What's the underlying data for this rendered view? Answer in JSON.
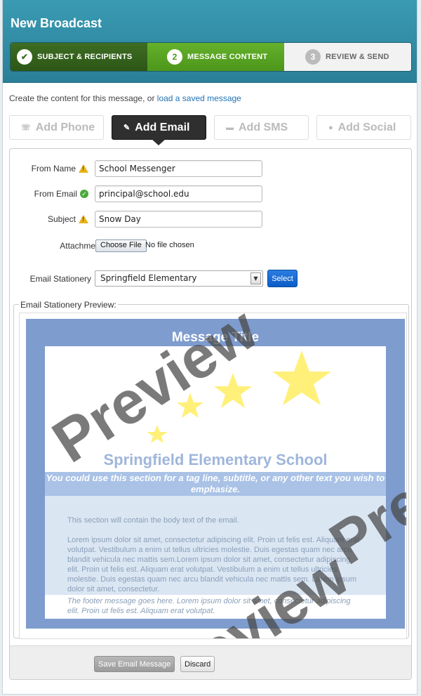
{
  "header": {
    "title": "New Broadcast"
  },
  "steps": [
    {
      "number": "✔",
      "label": "SUBJECT & RECIPIENTS",
      "state": "done"
    },
    {
      "number": "2",
      "label": "MESSAGE CONTENT",
      "state": "active"
    },
    {
      "number": "3",
      "label": "REVIEW & SEND",
      "state": "todo"
    }
  ],
  "intro": {
    "text": "Create the content for this message, or ",
    "link": "load a saved message"
  },
  "tabs": [
    {
      "label": "Add Phone",
      "icon": "phone-icon"
    },
    {
      "label": "Add Email",
      "icon": "pencil-icon"
    },
    {
      "label": "Add SMS",
      "icon": "chat-icon"
    },
    {
      "label": "Add Social",
      "icon": "user-icon"
    }
  ],
  "form": {
    "from_name": {
      "label": "From Name",
      "value": "School Messenger",
      "status": "warning"
    },
    "from_email": {
      "label": "From Email",
      "value": "principal@school.edu",
      "status": "ok"
    },
    "subject": {
      "label": "Subject",
      "value": "Snow Day",
      "status": "warning"
    },
    "attachments": {
      "label": "Attachments",
      "button": "Choose File",
      "text": "No file chosen"
    },
    "stationery": {
      "label": "Email Stationery",
      "selected": "Springfield Elementary",
      "button": "Select"
    }
  },
  "preview": {
    "legend": "Email Stationery Preview:",
    "message_title": "Message Title",
    "school_name": "Springfield Elementary School",
    "tagline": "You could use this section for a tag line, subtitle, or any other text you wish to emphasize.",
    "body_intro": "This section will contain the body text of the email.",
    "body_lorem": "Lorem ipsum dolor sit amet, consectetur adipiscing elit. Proin ut felis est. Aliquam erat volutpat. Vestibulum a enim ut tellus ultricies molestie. Duis egestas quam nec arcu blandit vehicula nec mattis sem.Lorem ipsum dolor sit amet, consectetur adipiscing elit. Proin ut felis est. Aliquam erat volutpat. Vestibulum a enim ut tellus ultricies molestie. Duis egestas quam nec arcu blandit vehicula nec mattis sem. Lorem ipsum dolor sit amet, consectetur.",
    "footer": "The footer message goes here. Lorem ipsum dolor sit amet, consectetur adipiscing elit. Proin ut felis est. Aliquam erat volutpat.",
    "watermark": "Preview",
    "star_color": "#fff07a"
  },
  "actions": {
    "save": "Save Email Message",
    "discard": "Discard"
  }
}
